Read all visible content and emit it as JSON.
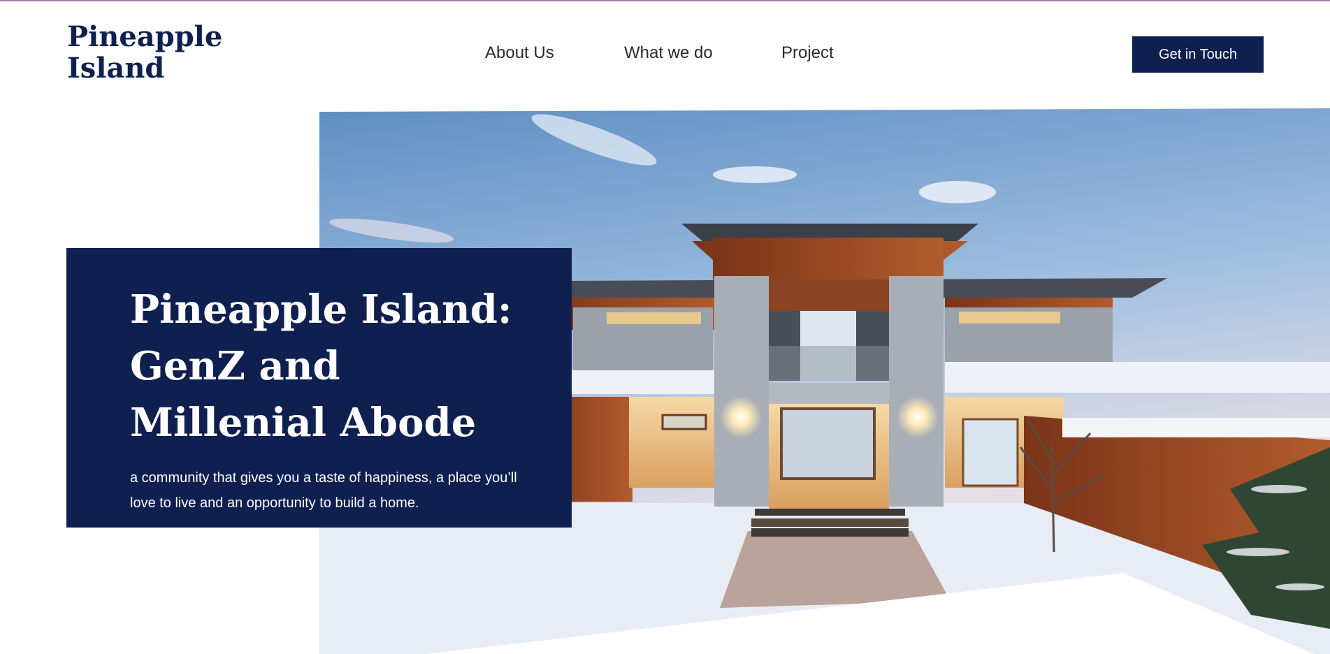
{
  "brand": {
    "logo_line1": "Pineapple",
    "logo_line2": "Island"
  },
  "nav": {
    "items": [
      {
        "label": "About Us"
      },
      {
        "label": "What we do"
      },
      {
        "label": "Project"
      }
    ],
    "cta_label": "Get in Touch"
  },
  "hero": {
    "title": "Pineapple Island: GenZ and Millenial Abode",
    "subtitle": "a community that gives you a taste of happiness, a place you’ll love to live and an opportunity to build a home."
  },
  "colors": {
    "brand_navy": "#0f1f4f",
    "sky": "#7fa6cf",
    "wood": "#9a4a25",
    "snow": "#e9eef6"
  }
}
